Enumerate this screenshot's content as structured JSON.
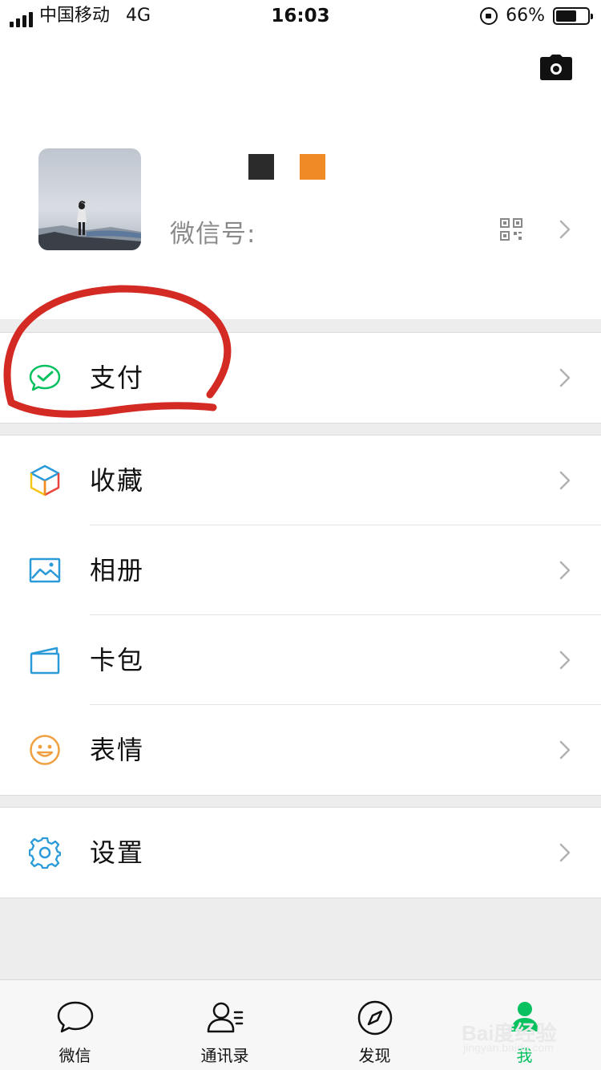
{
  "status_bar": {
    "carrier": "中国移动",
    "network": "4G",
    "time": "16:03",
    "battery_percent": "66%",
    "battery_level": 0.66
  },
  "profile": {
    "wechat_id_label": "微信号:",
    "nickname_block_colors": [
      "#2b2b2b",
      "#f08a24"
    ],
    "icons": [
      "camera-icon",
      "qr-code-icon",
      "chevron-right-icon"
    ]
  },
  "menu": {
    "pay": {
      "label": "支付",
      "icon": "wechat-pay-icon",
      "color": "#07c160"
    },
    "favorites": {
      "label": "收藏",
      "icon": "favorites-cube-icon"
    },
    "album": {
      "label": "相册",
      "icon": "album-icon",
      "color": "#2a9bd8"
    },
    "cards": {
      "label": "卡包",
      "icon": "card-wallet-icon",
      "color": "#2a9bd8"
    },
    "stickers": {
      "label": "表情",
      "icon": "smiley-icon",
      "color": "#f0a040"
    },
    "settings": {
      "label": "设置",
      "icon": "gear-icon",
      "color": "#2a9bd8"
    }
  },
  "tabs": [
    {
      "label": "微信",
      "icon": "chat-bubble-icon"
    },
    {
      "label": "通讯录",
      "icon": "contacts-icon"
    },
    {
      "label": "发现",
      "icon": "compass-icon"
    },
    {
      "label": "我",
      "icon": "me-person-icon",
      "active": true
    }
  ],
  "watermark": {
    "main": "Bai度经验",
    "sub": "jingyan.baidu.com"
  },
  "colors": {
    "accent": "#07c160",
    "annotation": "#d42a24"
  }
}
